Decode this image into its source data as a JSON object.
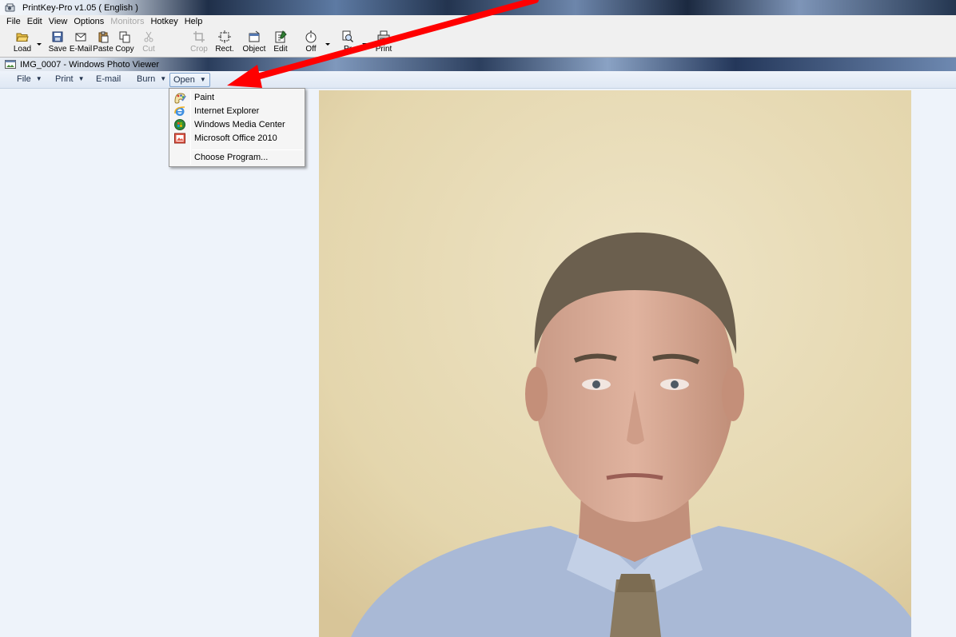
{
  "printkey": {
    "title": "PrintKey-Pro  v1.05 ( English )",
    "menu": [
      "File",
      "Edit",
      "View",
      "Options",
      "Monitors",
      "Hotkey",
      "Help"
    ],
    "menu_disabled": "Monitors",
    "toolbar": {
      "load": "Load",
      "save": "Save",
      "email": "E-Mail",
      "paste": "Paste",
      "copy": "Copy",
      "cut": "Cut",
      "crop": "Crop",
      "rect": "Rect.",
      "object": "Object",
      "edit": "Edit",
      "off": "Off",
      "preview": "Pr",
      "print": "Print"
    }
  },
  "photo_viewer": {
    "title": "IMG_0007 - Windows Photo Viewer",
    "commands": {
      "file": "File",
      "print": "Print",
      "email": "E-mail",
      "burn": "Burn",
      "open": "Open"
    },
    "caret": "▼",
    "open_menu": {
      "items": [
        "Paint",
        "Internet Explorer",
        "Windows Media Center",
        "Microsoft Office 2010"
      ],
      "choose": "Choose Program..."
    }
  },
  "annotation": {
    "arrow_color": "#ff0000"
  }
}
